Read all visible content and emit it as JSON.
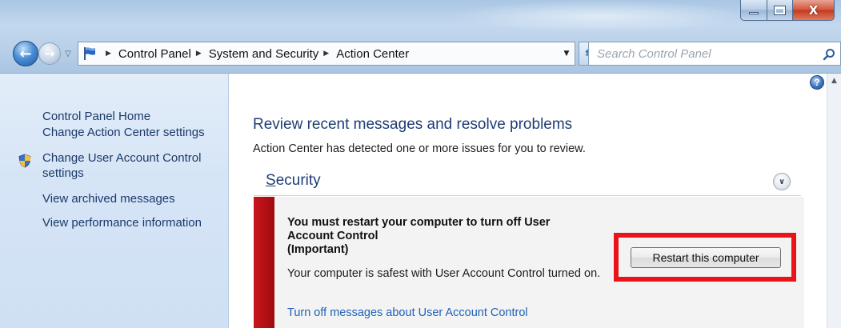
{
  "window": {
    "caption_buttons": {
      "minimize_icon": "minimize-icon",
      "maximize_icon": "maximize-icon",
      "close_label": "X"
    }
  },
  "address_bar": {
    "breadcrumbs": [
      {
        "label": "Control Panel"
      },
      {
        "label": "System and Security"
      },
      {
        "label": "Action Center"
      }
    ],
    "search_placeholder": "Search Control Panel"
  },
  "sidebar": {
    "home_label": "Control Panel Home",
    "links": [
      {
        "label": "Change Action Center settings"
      },
      {
        "label": "Change User Account Control settings"
      },
      {
        "label": "View archived messages"
      },
      {
        "label": "View performance information"
      }
    ]
  },
  "main": {
    "title": "Review recent messages and resolve problems",
    "subtitle": "Action Center has detected one or more issues for you to review.",
    "section": {
      "title_first_letter": "S",
      "title_rest": "ecurity",
      "message": {
        "title": "You must restart your computer to turn off User Account Control",
        "importance": "(Important)",
        "text": "Your computer is safest with User Account Control turned on.",
        "link": "Turn off messages about User Account Control",
        "button_label": "Restart this computer"
      }
    }
  },
  "colors": {
    "alert_red": "#b10e12",
    "highlight_red": "#e8141a",
    "link_blue": "#1f62b8",
    "heading_blue": "#1e3e75"
  }
}
